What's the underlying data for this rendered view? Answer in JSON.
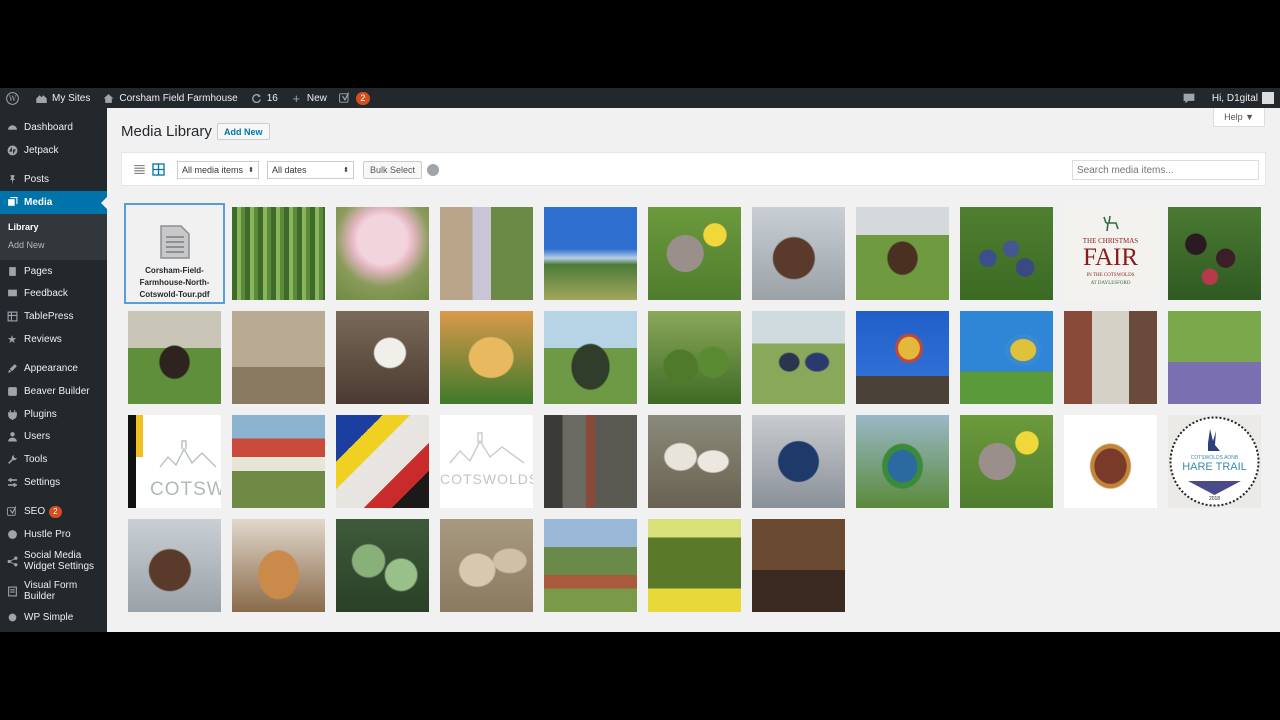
{
  "adminbar": {
    "my_sites": "My Sites",
    "site_name": "Corsham Field Farmhouse",
    "updates": "16",
    "new": "New",
    "notifications": "2",
    "greeting": "Hi, D1gital"
  },
  "sidebar": {
    "items": [
      {
        "label": "Dashboard"
      },
      {
        "label": "Jetpack"
      },
      {
        "label": "Posts"
      },
      {
        "label": "Media"
      },
      {
        "label": "Pages"
      },
      {
        "label": "Feedback"
      },
      {
        "label": "TablePress"
      },
      {
        "label": "Reviews"
      },
      {
        "label": "Appearance"
      },
      {
        "label": "Beaver Builder"
      },
      {
        "label": "Plugins"
      },
      {
        "label": "Users"
      },
      {
        "label": "Tools"
      },
      {
        "label": "Settings"
      },
      {
        "label": "SEO",
        "badge": "2"
      },
      {
        "label": "Hustle Pro"
      },
      {
        "label": "Social Media Widget Settings"
      },
      {
        "label": "Visual Form Builder"
      },
      {
        "label": "WP Simple"
      }
    ],
    "submenu": {
      "library": "Library",
      "add_new": "Add New"
    }
  },
  "main": {
    "title": "Media Library",
    "add_new": "Add New",
    "help": "Help ▼",
    "filter_type": "All media items",
    "filter_date": "All dates",
    "bulk_select": "Bulk Select",
    "search_placeholder": "Search media items...",
    "doc_filename": "Corsham-Field-Farmhouse-North-Cotswold-Tour.pdf",
    "tile_texts": {
      "christmas_line1": "THE CHRISTMAS",
      "christmas_line2": "FAIR",
      "christmas_line3": "IN THE COTSWOLDS",
      "christmas_line4": "AT DAYLESFORD",
      "cotswolds_short": "COTSWO",
      "cotswolds_full": "COTSWOLDS",
      "hare_line1": "COTSWOLDS AONB",
      "hare_line2": "HARE TRAIL",
      "hare_year": "2018"
    }
  },
  "colors": {
    "accent": "#0073aa",
    "adminbar_bg": "#23282d",
    "badge": "#d54e21"
  }
}
